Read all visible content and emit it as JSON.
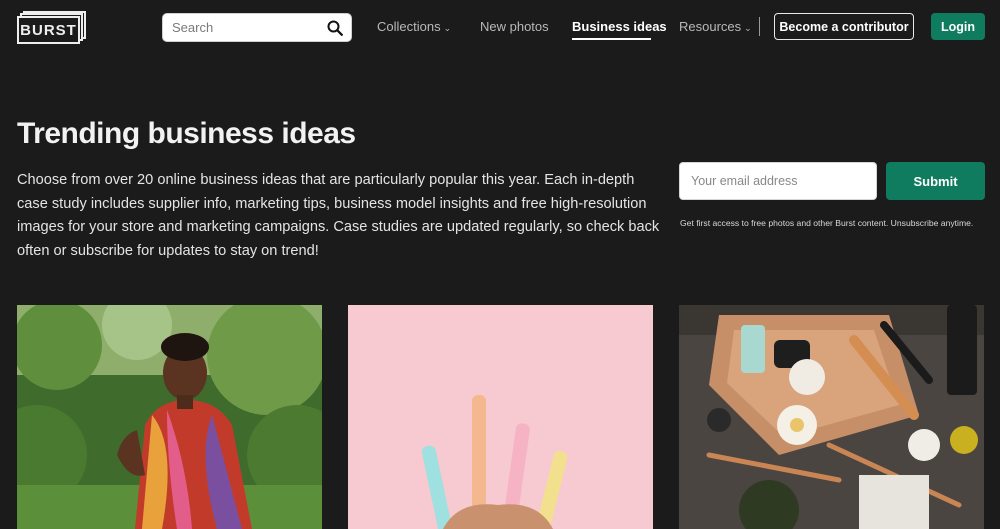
{
  "header": {
    "logo_text": "BURST",
    "search": {
      "placeholder": "Search"
    },
    "nav": [
      {
        "label": "Collections",
        "has_dropdown": true
      },
      {
        "label": "New photos",
        "has_dropdown": false
      },
      {
        "label": "Business ideas",
        "active": true
      },
      {
        "label": "Resources",
        "has_dropdown": true
      }
    ],
    "contributor_button": "Become a contributor",
    "login_button": "Login"
  },
  "hero": {
    "title": "Trending business ideas",
    "description": "Choose from over 20 online business ideas that are particularly popular this year. Each in-depth case study includes supplier info, marketing tips, business model insights and free high-resolution images for your store and marketing campaigns. Case studies are updated regularly, so check back often or subscribe for updates to stay on trend!",
    "subscribe": {
      "email_placeholder": "Your email address",
      "submit_label": "Submit",
      "note": "Get first access to free photos and other Burst content. Unsubscribe anytime."
    }
  },
  "cards": [
    {
      "image_subject": "woman-in-colorful-scarf-photo"
    },
    {
      "image_subject": "pastel-pens-on-pink-photo"
    },
    {
      "image_subject": "makeup-brushes-flatlay-photo"
    }
  ],
  "colors": {
    "background": "#1b1b1b",
    "accent_green": "#0f7c5f",
    "text": "#eeeeee"
  }
}
